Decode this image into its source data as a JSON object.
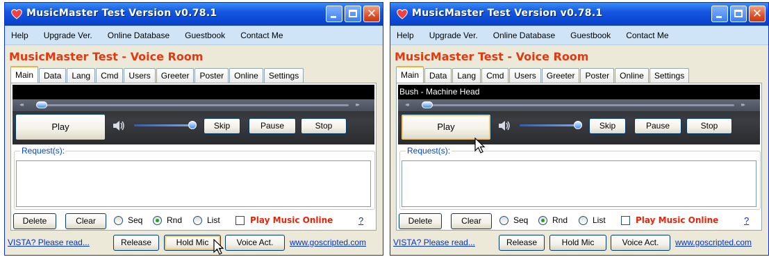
{
  "windows": [
    {
      "title": "MusicMaster Test Version v0.78.1",
      "menu": [
        "Help",
        "Upgrade Ver.",
        "Online Database",
        "Guestbook",
        "Contact Me"
      ],
      "room_title": "MusicMaster Test - Voice Room",
      "tabs": [
        "Main",
        "Data",
        "Lang",
        "Cmd",
        "Users",
        "Greeter",
        "Poster",
        "Online",
        "Settings"
      ],
      "active_tab": "Main",
      "now_playing": "",
      "buttons": {
        "play": "Play",
        "skip": "Skip",
        "pause": "Pause",
        "stop": "Stop",
        "delete": "Delete",
        "clear": "Clear"
      },
      "requests_label": "Request(s):",
      "radio": [
        "Seq",
        "Rnd",
        "List"
      ],
      "selected_radio": "Rnd",
      "play_online": "Play Music Online",
      "help_link": "?",
      "footer": {
        "vista": "VISTA? Please read...",
        "release": "Release",
        "hold": "Hold Mic",
        "voice": "Voice Act.",
        "url": "www.goscripted.com"
      },
      "focused_button": "hold",
      "seek_position": 0.04,
      "volume_level": 1.0
    },
    {
      "title": "MusicMaster Test Version v0.78.1",
      "menu": [
        "Help",
        "Upgrade Ver.",
        "Online Database",
        "Guestbook",
        "Contact Me"
      ],
      "room_title": "MusicMaster Test - Voice Room",
      "tabs": [
        "Main",
        "Data",
        "Lang",
        "Cmd",
        "Users",
        "Greeter",
        "Poster",
        "Online",
        "Settings"
      ],
      "active_tab": "Main",
      "now_playing": "Bush - Machine Head",
      "buttons": {
        "play": "Play",
        "skip": "Skip",
        "pause": "Pause",
        "stop": "Stop",
        "delete": "Delete",
        "clear": "Clear"
      },
      "requests_label": "Request(s):",
      "radio": [
        "Seq",
        "Rnd",
        "List"
      ],
      "selected_radio": "Rnd",
      "play_online": "Play Music Online",
      "help_link": "?",
      "footer": {
        "vista": "VISTA? Please read...",
        "release": "Release",
        "hold": "Hold Mic",
        "voice": "Voice Act.",
        "url": "www.goscripted.com"
      },
      "focused_button": "play",
      "seek_position": 0.04,
      "volume_level": 1.0
    }
  ],
  "colors": {
    "title_accent": "#e33810",
    "link": "#0033cc",
    "xp_blue": "#0a46d0",
    "play_online": "#e5240c"
  },
  "icons": [
    "heart-app-icon",
    "minimize-icon",
    "maximize-icon",
    "close-icon",
    "speaker-icon",
    "mouse-cursor-icon"
  ]
}
